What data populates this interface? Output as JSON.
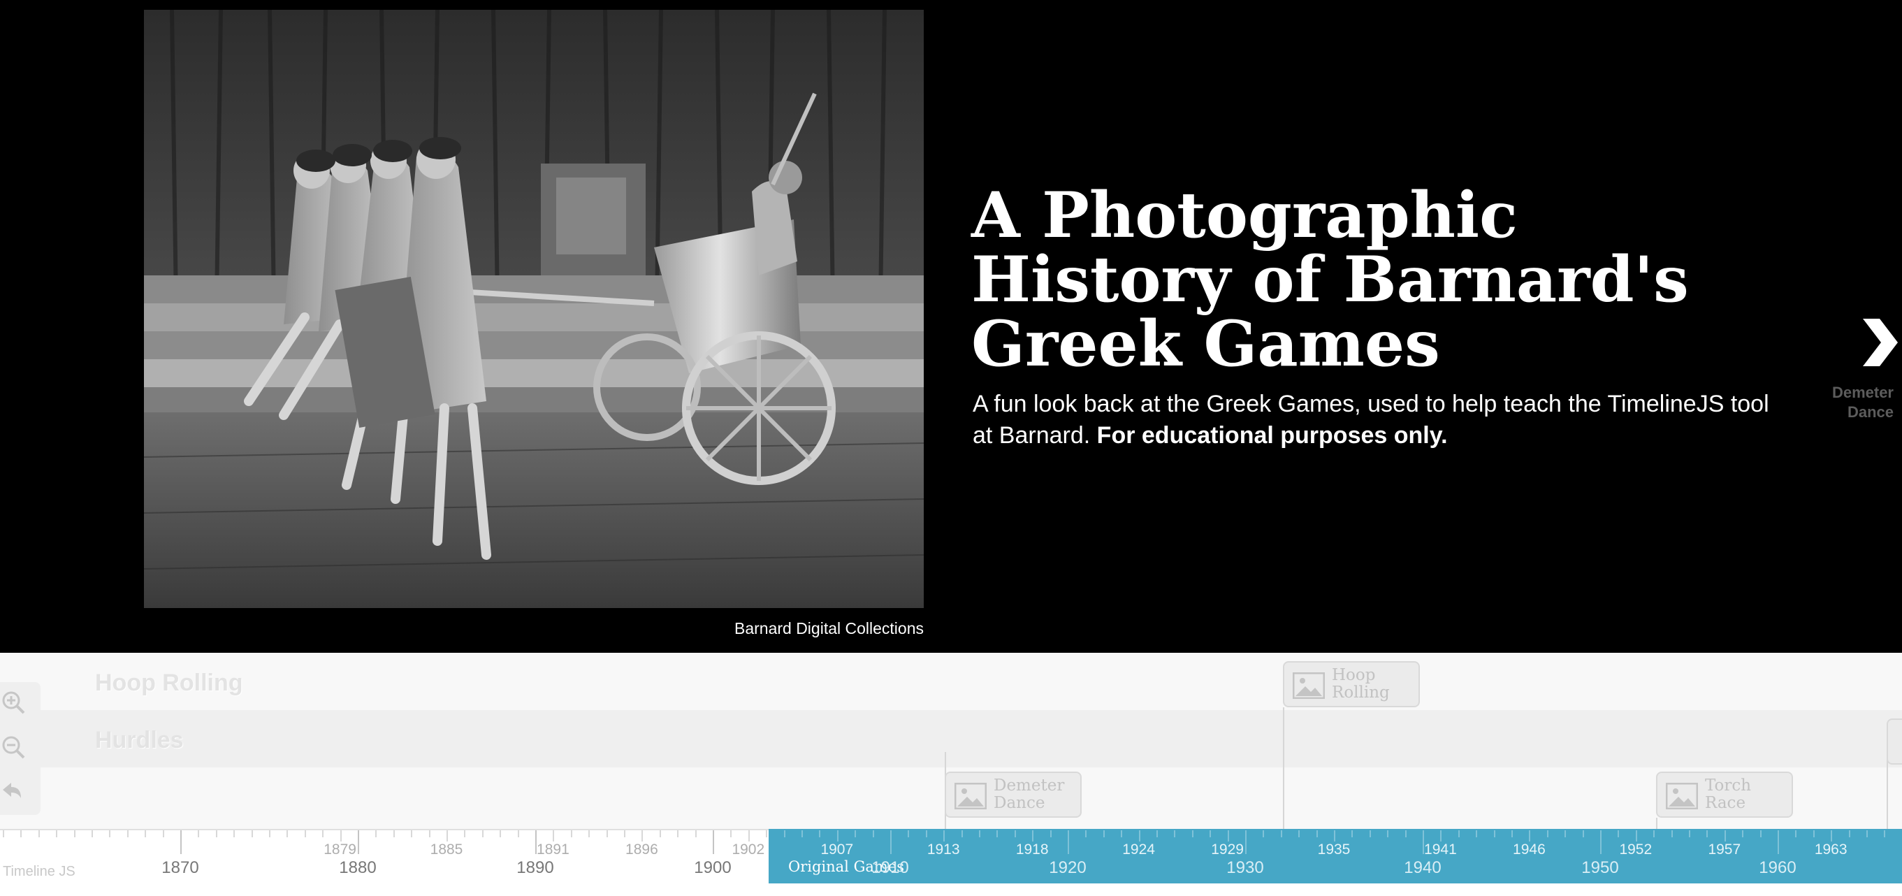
{
  "slide": {
    "title": "A Photographic History of Barnard's Greek Games",
    "description_plain": "A fun look back at the Greek Games, used to help teach the TimelineJS tool at Barnard.",
    "description_bold": "For educational purposes only.",
    "media_caption": "Barnard Digital Collections",
    "photo_subject": "black-and-white photograph of dancers pulling a chariot on a stage",
    "next": {
      "label": "Demeter Dance",
      "icon": "chevron-right-icon"
    }
  },
  "timeline": {
    "groups": [
      {
        "label": "Hoop Rolling"
      },
      {
        "label": "Hurdles"
      }
    ],
    "zoom_controls": [
      {
        "name": "zoom-in-button",
        "icon": "zoom-in-icon"
      },
      {
        "name": "zoom-out-button",
        "icon": "zoom-out-icon"
      },
      {
        "name": "back-to-start-button",
        "icon": "back-arrow-icon"
      }
    ],
    "markers": [
      {
        "label": "Demeter Dance",
        "row": 2
      },
      {
        "label": "Hoop Rolling",
        "row": 0
      },
      {
        "label": "Torch Race",
        "row": 2
      }
    ],
    "era": {
      "label": "Original Games"
    },
    "major_ticks": [
      "1870",
      "1880",
      "1890",
      "1900",
      "1910",
      "1920",
      "1930",
      "1940",
      "1950",
      "1960"
    ],
    "minor_ticks": [
      "1879",
      "1885",
      "1891",
      "1896",
      "1902",
      "1907",
      "1913",
      "1918",
      "1924",
      "1929",
      "1935",
      "1941",
      "1946",
      "1952",
      "1957",
      "1963"
    ],
    "credit": "Timeline JS"
  }
}
